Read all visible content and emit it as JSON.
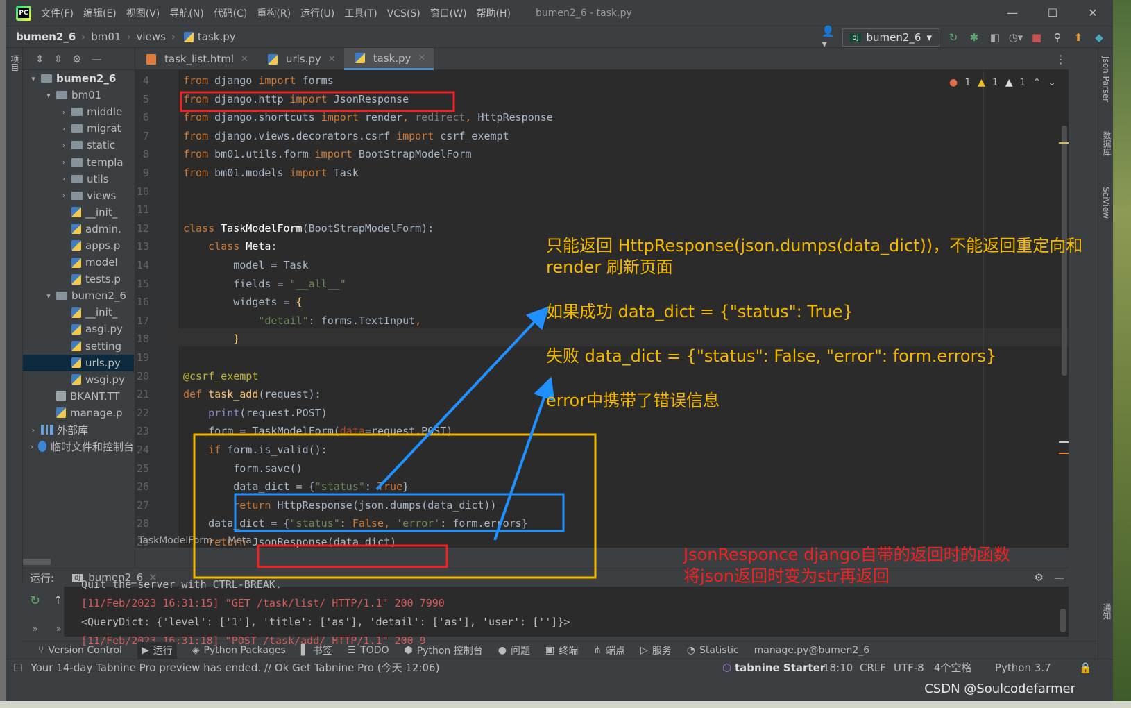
{
  "titlebar": {
    "menus": [
      "文件(F)",
      "编辑(E)",
      "视图(V)",
      "导航(N)",
      "代码(C)",
      "重构(R)",
      "运行(U)",
      "工具(T)",
      "VCS(S)",
      "窗口(W)",
      "帮助(H)"
    ],
    "window_title": "bumen2_6 - task.py",
    "minimize": "—",
    "maximize": "☐",
    "close": "✕"
  },
  "navbar": {
    "crumbs": [
      "bumen2_6",
      "bm01",
      "views",
      "task.py"
    ],
    "run_config": "bumen2_6"
  },
  "lstrip_label": "项目",
  "project_tree": [
    {
      "indent": 0,
      "arrow": "▾",
      "kind": "folder",
      "label": "bumen2_6"
    },
    {
      "indent": 1,
      "arrow": "▾",
      "kind": "folder",
      "label": "bm01"
    },
    {
      "indent": 2,
      "arrow": "›",
      "kind": "folder",
      "label": "middle"
    },
    {
      "indent": 2,
      "arrow": "›",
      "kind": "folder",
      "label": "migrat"
    },
    {
      "indent": 2,
      "arrow": "›",
      "kind": "folder",
      "label": "static"
    },
    {
      "indent": 2,
      "arrow": "›",
      "kind": "folder",
      "label": "templa"
    },
    {
      "indent": 2,
      "arrow": "›",
      "kind": "folder",
      "label": "utils"
    },
    {
      "indent": 2,
      "arrow": "›",
      "kind": "folder",
      "label": "views"
    },
    {
      "indent": 2,
      "arrow": "",
      "kind": "py",
      "label": "__init_"
    },
    {
      "indent": 2,
      "arrow": "",
      "kind": "py",
      "label": "admin."
    },
    {
      "indent": 2,
      "arrow": "",
      "kind": "py",
      "label": "apps.p"
    },
    {
      "indent": 2,
      "arrow": "",
      "kind": "py",
      "label": "model"
    },
    {
      "indent": 2,
      "arrow": "",
      "kind": "py",
      "label": "tests.p"
    },
    {
      "indent": 1,
      "arrow": "▾",
      "kind": "folder",
      "label": "bumen2_6"
    },
    {
      "indent": 2,
      "arrow": "",
      "kind": "py",
      "label": "__init_"
    },
    {
      "indent": 2,
      "arrow": "",
      "kind": "py",
      "label": "asgi.py"
    },
    {
      "indent": 2,
      "arrow": "",
      "kind": "py",
      "label": "setting"
    },
    {
      "indent": 2,
      "arrow": "",
      "kind": "py",
      "label": "urls.py",
      "selected": true
    },
    {
      "indent": 2,
      "arrow": "",
      "kind": "py",
      "label": "wsgi.py"
    },
    {
      "indent": 1,
      "arrow": "",
      "kind": "txt",
      "label": "BKANT.TT"
    },
    {
      "indent": 1,
      "arrow": "",
      "kind": "py",
      "label": "manage.p"
    },
    {
      "indent": 0,
      "arrow": "›",
      "kind": "lib",
      "label": "外部库"
    },
    {
      "indent": 0,
      "arrow": "›",
      "kind": "scratch",
      "label": "临时文件和控制台"
    }
  ],
  "tabs": [
    {
      "label": "task_list.html",
      "active": false
    },
    {
      "label": "urls.py",
      "active": false
    },
    {
      "label": "task.py",
      "active": true
    }
  ],
  "inspections": {
    "errors": "1",
    "warnings": "1",
    "weak": "1"
  },
  "code_lines": [
    {
      "n": "4",
      "html": "<span class='k'>from</span> django <span class='k'>import</span> forms"
    },
    {
      "n": "5",
      "html": "<span class='k'>from</span> django.http <span class='k'>import</span> JsonResponse"
    },
    {
      "n": "6",
      "html": "<span class='k'>from</span> django.shortcuts <span class='k'>import</span> render<span class='k'>,</span> <span class='g'>redirect</span><span class='k'>,</span> HttpResponse"
    },
    {
      "n": "7",
      "html": "<span class='k'>from</span> django.views.decorators.csrf <span class='k'>import</span> csrf_exempt"
    },
    {
      "n": "8",
      "html": "<span class='k'>from</span> bm01.utils.form <span class='k'>import</span> BootStrapModelForm"
    },
    {
      "n": "9",
      "html": "<span class='k'>from</span> bm01.models <span class='k'>import</span> Task"
    },
    {
      "n": "10",
      "html": ""
    },
    {
      "n": "11",
      "html": ""
    },
    {
      "n": "12",
      "html": "<span class='k'>class</span> <span class='cls'>TaskModelForm</span>(BootStrapModelForm):"
    },
    {
      "n": "13",
      "html": "    <span class='k'>class</span> <span class='cls'>Meta</span>:"
    },
    {
      "n": "14",
      "html": "        model = Task"
    },
    {
      "n": "15",
      "html": "        fields = <span class='s'>\"__all__\"</span>"
    },
    {
      "n": "16",
      "html": "        widgets = <span class='f'>{</span>"
    },
    {
      "n": "17",
      "html": "            <span class='s'>\"detail\"</span>: forms.TextInput<span class='k'>,</span>"
    },
    {
      "n": "18",
      "html": "        <span class='f'>}</span>"
    },
    {
      "n": "19",
      "html": ""
    },
    {
      "n": "20",
      "html": "<span class='d'>@csrf_exempt</span>"
    },
    {
      "n": "21",
      "html": "<span class='k'>def</span> <span class='f'>task_add</span>(request):"
    },
    {
      "n": "22",
      "html": "    <span class='b'>print</span>(request.POST)"
    },
    {
      "n": "23",
      "html": "    form = TaskModelForm(<span class='pm'>data</span>=request.POST)"
    },
    {
      "n": "24",
      "html": "    <span class='k'>if</span> form.is_valid():"
    },
    {
      "n": "25",
      "html": "        form.save()"
    },
    {
      "n": "26",
      "html": "        data_dict = {<span class='s'>\"status\"</span>: <span class='k'>True</span>}"
    },
    {
      "n": "27",
      "html": "        <span class='k'>return</span> HttpResponse(json.dumps(data_dict))"
    },
    {
      "n": "28",
      "html": "    data_dict = {<span class='s'>\"status\"</span>: <span class='k'>False</span><span class='k'>,</span> <span class='s'>'error'</span>: form.errors}"
    },
    {
      "n": "29",
      "html": "    <span class='k'>return</span> JsonResponse(data_dict)"
    }
  ],
  "editor_breadcrumb": [
    "TaskModelForm",
    "Meta"
  ],
  "annotations": {
    "note1": "只能返回 HttpResponse(json.dumps(data_dict))，不能返回重定向和render 刷新页面",
    "note2": "如果成功  data_dict = {\"status\": True}",
    "note3": "失败 data_dict = {\"status\": False, \"error\": form.errors}",
    "note4": "error中携带了错误信息",
    "note5_line1": "JsonResponce django自带的返回时的函数",
    "note5_line2": "将json返回时变为str再返回",
    "color_yellow": "#f5b800",
    "color_blue": "#1e90ff",
    "color_red": "#ee2222"
  },
  "run_panel": {
    "label": "运行:",
    "config": "bumen2_6",
    "console": [
      {
        "text": "Quit the server with CTRL-BREAK.",
        "color": "#bbbbbb"
      },
      {
        "text": "[11/Feb/2023 16:31:15] \"GET /task/list/ HTTP/1.1\" 200 7990",
        "color": "#d95c5c"
      },
      {
        "text": "<QueryDict: {'level': ['1'], 'title': ['as'], 'detail': ['as'], 'user': ['']}>",
        "color": "#bbbbbb"
      },
      {
        "text": "[11/Feb/2023 16:31:18] \"POST /task/add/ HTTP/1.1\" 200 9",
        "color": "#d95c5c"
      }
    ]
  },
  "toolwindows": [
    {
      "icon": "⑂",
      "label": "Version Control"
    },
    {
      "icon": "▶",
      "label": "运行",
      "active": true
    },
    {
      "icon": "◈",
      "label": "Python Packages"
    },
    {
      "icon": "▌",
      "label": "书签"
    },
    {
      "icon": "☰",
      "label": "TODO"
    },
    {
      "icon": "⬢",
      "label": "Python 控制台"
    },
    {
      "icon": "●",
      "label": "问题"
    },
    {
      "icon": "▣",
      "label": "终端"
    },
    {
      "icon": "⋔",
      "label": "端点"
    },
    {
      "icon": "▷",
      "label": "服务"
    },
    {
      "icon": "◔",
      "label": "Statistic"
    },
    {
      "icon": "",
      "label": "manage.py@bumen2_6"
    }
  ],
  "statusbar": {
    "message": "Your 14-day Tabnine Pro preview has ended. // Ok   Get Tabnine Pro (今天 12:06)",
    "tabnine": "tabnine Starter",
    "position": "18:10",
    "line_sep": "CRLF",
    "encoding": "UTF-8",
    "indent": "4个空格",
    "interpreter": "Python 3.7"
  },
  "right_strip": [
    "Json Parser",
    "数据库",
    "SciView",
    "通知"
  ],
  "watermark": "CSDN @Soulcodefarmer"
}
